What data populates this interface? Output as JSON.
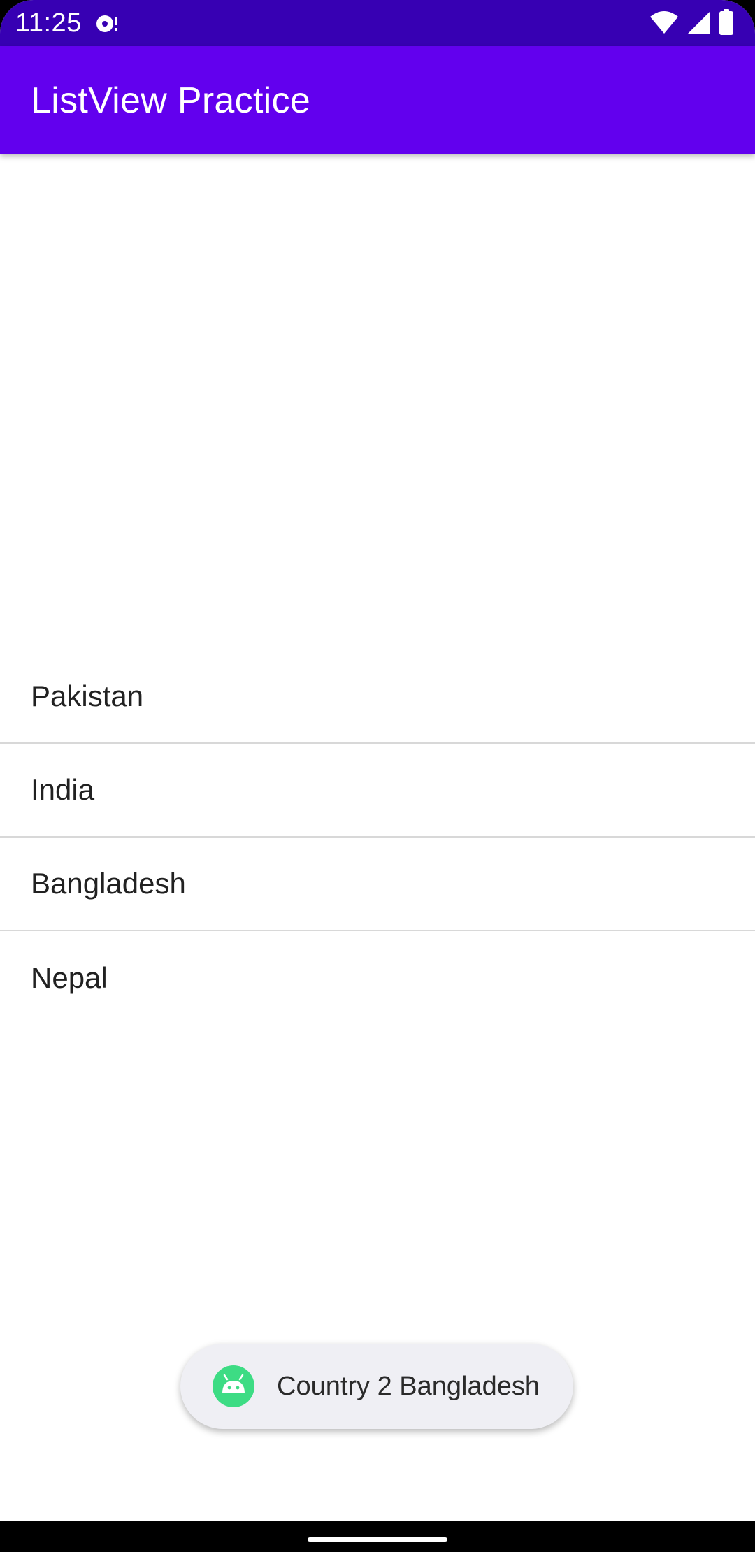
{
  "status_bar": {
    "time": "11:25",
    "notification_icon": "media-notification-icon",
    "wifi_icon": "wifi-icon",
    "signal_icon": "cell-signal-icon",
    "battery_icon": "battery-icon",
    "background_color": "#3700b3"
  },
  "app_bar": {
    "title": "ListView Practice",
    "background_color": "#6200ee"
  },
  "list": {
    "items": [
      {
        "label": "Pakistan"
      },
      {
        "label": "India"
      },
      {
        "label": "Bangladesh"
      },
      {
        "label": "Nepal"
      }
    ]
  },
  "toast": {
    "icon": "android-app-icon",
    "message": "Country 2 Bangladesh"
  },
  "nav_bar": {
    "handle": "home-gesture-handle"
  }
}
